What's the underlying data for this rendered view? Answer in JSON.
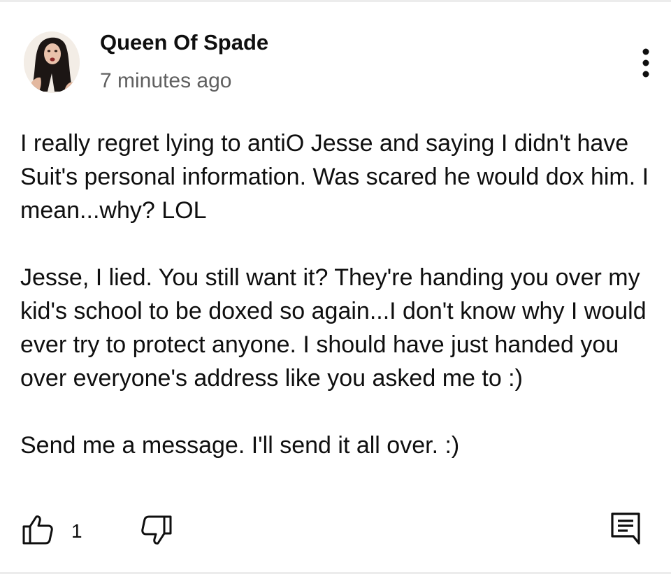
{
  "comment": {
    "author": "Queen Of Spade",
    "timestamp": "7 minutes ago",
    "paragraphs": [
      "I really regret lying to antiO Jesse and saying I didn't have Suit's personal information. Was scared he would dox him. I mean...why? LOL",
      "Jesse, I lied. You still want it? They're handing you over my kid's school to be doxed so again...I don't know why I would ever try to protect anyone. I should have just handed you over everyone's address like you asked me to :)",
      "Send me a message. I'll send it all over. :)"
    ],
    "like_count": "1"
  },
  "icons": {
    "avatar": "avatar-image",
    "more": "more-vert-icon",
    "like": "thumb-up-icon",
    "dislike": "thumb-down-icon",
    "reply": "reply-comment-icon"
  },
  "colors": {
    "text": "#0f0f0f",
    "secondary_text": "#606060",
    "icon": "#0f0f0f"
  }
}
